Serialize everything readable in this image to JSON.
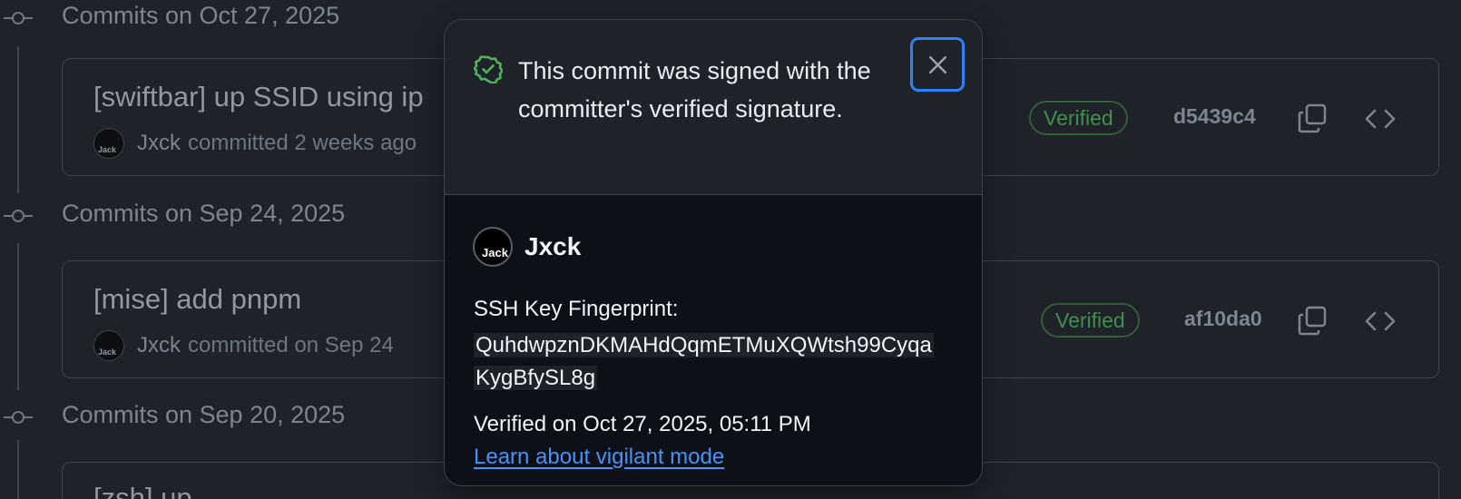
{
  "groups": [
    {
      "title": "Commits on Oct 27, 2025",
      "commit": {
        "title": "[swiftbar] up SSID using ip",
        "avatar_text": "Jack",
        "author": "Jxck",
        "committed_text": "committed 2 weeks ago",
        "badge": "Verified",
        "sha": "d5439c4"
      }
    },
    {
      "title": "Commits on Sep 24, 2025",
      "commit": {
        "title": "[mise] add pnpm",
        "avatar_text": "Jack",
        "author": "Jxck",
        "committed_text": "committed on Sep 24",
        "badge": "Verified",
        "sha": "af10da0"
      }
    },
    {
      "title": "Commits on Sep 20, 2025",
      "commit": {
        "title": "[zsh] up"
      }
    }
  ],
  "popover": {
    "signed_text": "This commit was signed with the committer's verified signature.",
    "user": "Jxck",
    "avatar_text": "Jack",
    "key_label": "SSH Key Fingerprint:",
    "fingerprint_line1": "QuhdwpznDKMAHdQqmETMuXQWtsh99Cyqa",
    "fingerprint_line2": "KygBfySL8g",
    "verified_on": "Verified on Oct 27, 2025, 05:11 PM",
    "learn_link": "Learn about vigilant mode"
  },
  "colors": {
    "background": "#1f2329",
    "verified": "#3f8f4d",
    "link": "#4493f8",
    "focus": "#2f81f7"
  },
  "icons": {
    "copy": "copy-icon",
    "code": "code-icon",
    "verified": "shield-check-icon",
    "close": "x-icon",
    "timeline": "commit-node-icon"
  }
}
